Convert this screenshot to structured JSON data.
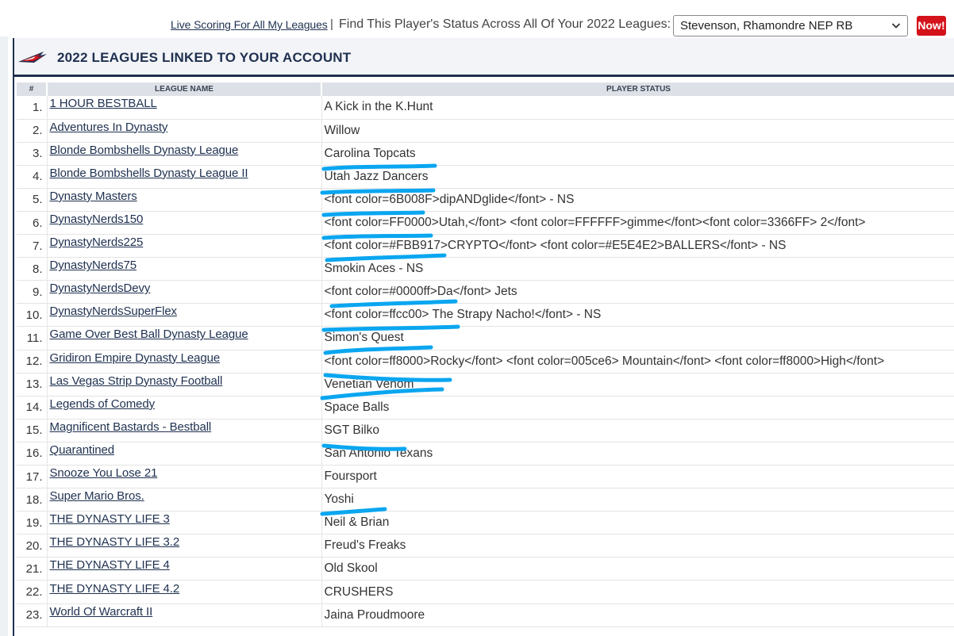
{
  "toolbar": {
    "live_scoring_link": "Live Scoring For All My Leagues",
    "separator": "|",
    "find_text": "Find This Player's Status Across All Of Your 2022 Leagues:",
    "player_select_value": "Stevenson, Rhamondre NEP RB",
    "now_button": "Now!"
  },
  "panel": {
    "title": "2022 LEAGUES LINKED TO YOUR ACCOUNT"
  },
  "table": {
    "headers": [
      "#",
      "LEAGUE NAME",
      "PLAYER STATUS"
    ],
    "rows": [
      {
        "num": "1.",
        "league": "1 HOUR BESTBALL",
        "status": "A Kick in the K.Hunt"
      },
      {
        "num": "2.",
        "league": "Adventures In Dynasty",
        "status": "Willow"
      },
      {
        "num": "3.",
        "league": "Blonde Bombshells Dynasty League",
        "status": "Carolina Topcats"
      },
      {
        "num": "4.",
        "league": "Blonde Bombshells Dynasty League II",
        "status": "Utah Jazz Dancers"
      },
      {
        "num": "5.",
        "league": "Dynasty Masters",
        "status": "<font color=6B008F>dipANDglide</font> - NS"
      },
      {
        "num": "6.",
        "league": "DynastyNerds150",
        "status": "<font color=FF0000>Utah,</font> <font color=FFFFFF>gimme</font><font color=3366FF> 2</font>"
      },
      {
        "num": "7.",
        "league": "DynastyNerds225",
        "status": "<font color=#FBB917>CRYPTO</font> <font color=#E5E4E2>BALLERS</font> - NS"
      },
      {
        "num": "8.",
        "league": "DynastyNerds75",
        "status": "Smokin Aces - NS"
      },
      {
        "num": "9.",
        "league": "DynastyNerdsDevy",
        "status": "<font color=#0000ff>Da</font> Jets"
      },
      {
        "num": "10.",
        "league": "DynastyNerdsSuperFlex",
        "status": "<font color=ffcc00> The Strapy Nacho!</font> - NS"
      },
      {
        "num": "11.",
        "league": "Game Over Best Ball Dynasty League",
        "status": "Simon's Quest"
      },
      {
        "num": "12.",
        "league": "Gridiron Empire Dynasty League",
        "status": "<font color=ff8000>Rocky</font> <font color=005ce6> Mountain</font> <font color=ff8000>High</font>"
      },
      {
        "num": "13.",
        "league": "Las Vegas Strip Dynasty Football",
        "status": "Venetian Venom"
      },
      {
        "num": "14.",
        "league": "Legends of Comedy",
        "status": "Space Balls"
      },
      {
        "num": "15.",
        "league": "Magnificent Bastards - Bestball",
        "status": "SGT Bilko"
      },
      {
        "num": "16.",
        "league": "Quarantined",
        "status": "San Antonio Texans"
      },
      {
        "num": "17.",
        "league": "Snooze You Lose 21",
        "status": "Foursport"
      },
      {
        "num": "18.",
        "league": "Super Mario Bros.",
        "status": "Yoshi"
      },
      {
        "num": "19.",
        "league": "THE DYNASTY LIFE 3",
        "status": "Neil & Brian"
      },
      {
        "num": "20.",
        "league": "THE DYNASTY LIFE 3.2",
        "status": "Freud's Freaks"
      },
      {
        "num": "21.",
        "league": "THE DYNASTY LIFE 4",
        "status": "Old Skool"
      },
      {
        "num": "22.",
        "league": "THE DYNASTY LIFE 4.2",
        "status": "CRUSHERS"
      },
      {
        "num": "23.",
        "league": "World Of Warcraft II",
        "status": "Jaina Proudmoore"
      }
    ]
  },
  "colors": {
    "navy": "#1f2f4f",
    "link": "#1f3150",
    "now_red": "#d4121a",
    "annotation_blue": "#0aa6f0"
  }
}
